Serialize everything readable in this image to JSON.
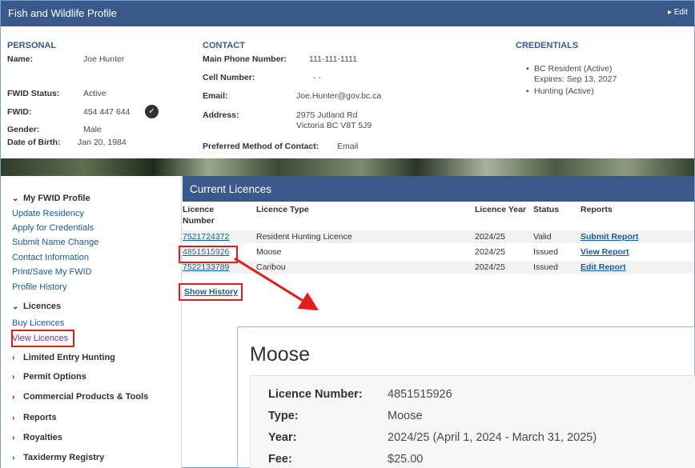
{
  "header": {
    "title": "Fish and Wildlife Profile",
    "edit_label": "▸ Edit"
  },
  "personal": {
    "heading": "PERSONAL",
    "name_label": "Name:",
    "name": "Joe Hunter",
    "fwid_status_label": "FWID Status:",
    "fwid_status": "Active",
    "fwid_label": "FWID:",
    "fwid": "454 447 644",
    "gender_label": "Gender:",
    "gender": "Male",
    "dob_label": "Date of Birth:",
    "dob": "Jan 20, 1984"
  },
  "contact": {
    "heading": "CONTACT",
    "main_phone_label": "Main Phone Number:",
    "main_phone": "111-111-1111",
    "cell_label": "Cell Number:",
    "cell": "- -",
    "email_label": "Email:",
    "email": "Joe.Hunter@gov.bc.ca",
    "address_label": "Address:",
    "address_line1": "2975 Jutland Rd",
    "address_line2": "Victoria BC V8T 5J9",
    "preferred_label": "Preferred Method of Contact:",
    "preferred": "Email"
  },
  "credentials": {
    "heading": "CREDENTIALS",
    "items": [
      {
        "text": "BC Resident (Active)",
        "sub": "Expires: Sep 13, 2027"
      },
      {
        "text": "Hunting (Active)",
        "sub": ""
      }
    ]
  },
  "sidebar": {
    "my_profile": "My FWID Profile",
    "profile_links": [
      "Update Residency",
      "Apply for Credentials",
      "Submit Name Change",
      "Contact Information",
      "Print/Save My FWID",
      "Profile History"
    ],
    "licences": "Licences",
    "licence_links": [
      "Buy Licences",
      "View Licences"
    ],
    "groups": [
      "Limited Entry Hunting",
      "Permit Options",
      "Commercial Products & Tools",
      "Reports",
      "Royalties",
      "Taxidermy Registry"
    ]
  },
  "current_licences": {
    "heading": "Current Licences",
    "columns": [
      "Licence Number",
      "Licence Type",
      "Licence Year",
      "Status",
      "Reports"
    ],
    "rows": [
      {
        "number": "7521724372",
        "type": "Resident Hunting Licence",
        "year": "2024/25",
        "status": "Valid",
        "report": "Submit Report"
      },
      {
        "number": "4851515926",
        "type": "Moose",
        "year": "2024/25",
        "status": "Issued",
        "report": "View Report"
      },
      {
        "number": "7522133789",
        "type": "Caribou",
        "year": "2024/25",
        "status": "Issued",
        "report": "Edit Report"
      }
    ],
    "show_history": "Show History"
  },
  "detail": {
    "title": "Moose",
    "number_label": "Licence Number:",
    "number": "4851515926",
    "type_label": "Type:",
    "type": "Moose",
    "year_label": "Year:",
    "year": "2024/25 (April 1, 2024 - March 31, 2025)",
    "fee_label": "Fee:",
    "fee": "$25.00"
  },
  "colors": {
    "header": "#38598a",
    "link": "#1a5a96",
    "highlight": "#e21d1d"
  },
  "icons": [
    "verified-check-icon",
    "chevron-down-icon",
    "chevron-right-icon",
    "arrow-icon"
  ]
}
